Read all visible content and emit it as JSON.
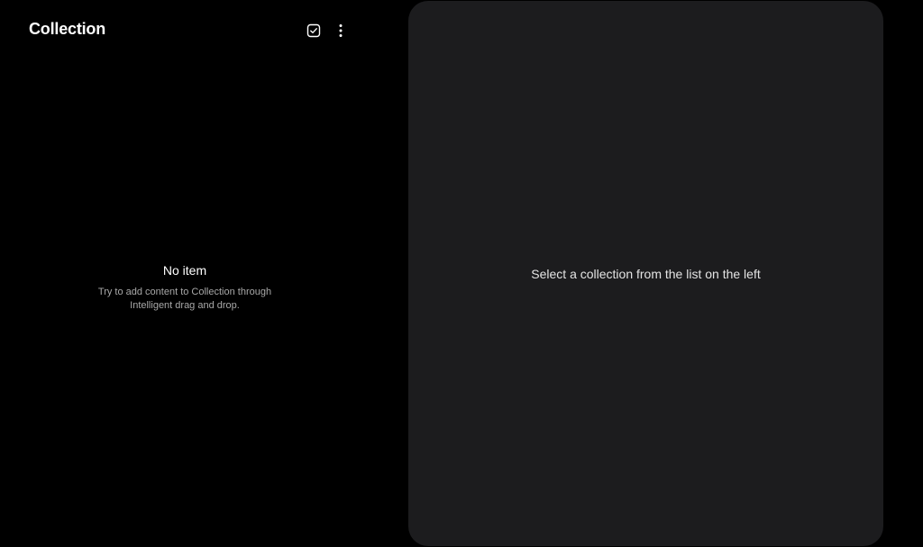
{
  "app_bar": {
    "title": "Collection",
    "icons": [
      "select-checkbox-icon",
      "more-options-icon"
    ]
  },
  "list_pane": {
    "empty_title": "No item",
    "empty_description": "Try to add content to Collection through Intelligent drag and drop."
  },
  "detail_pane": {
    "hint": "Select a collection from the list on the left"
  },
  "colors": {
    "background": "#000000",
    "detail_panel": "#1c1c1e",
    "primary_text": "#ffffff",
    "secondary_text": "#a8a8a8"
  }
}
